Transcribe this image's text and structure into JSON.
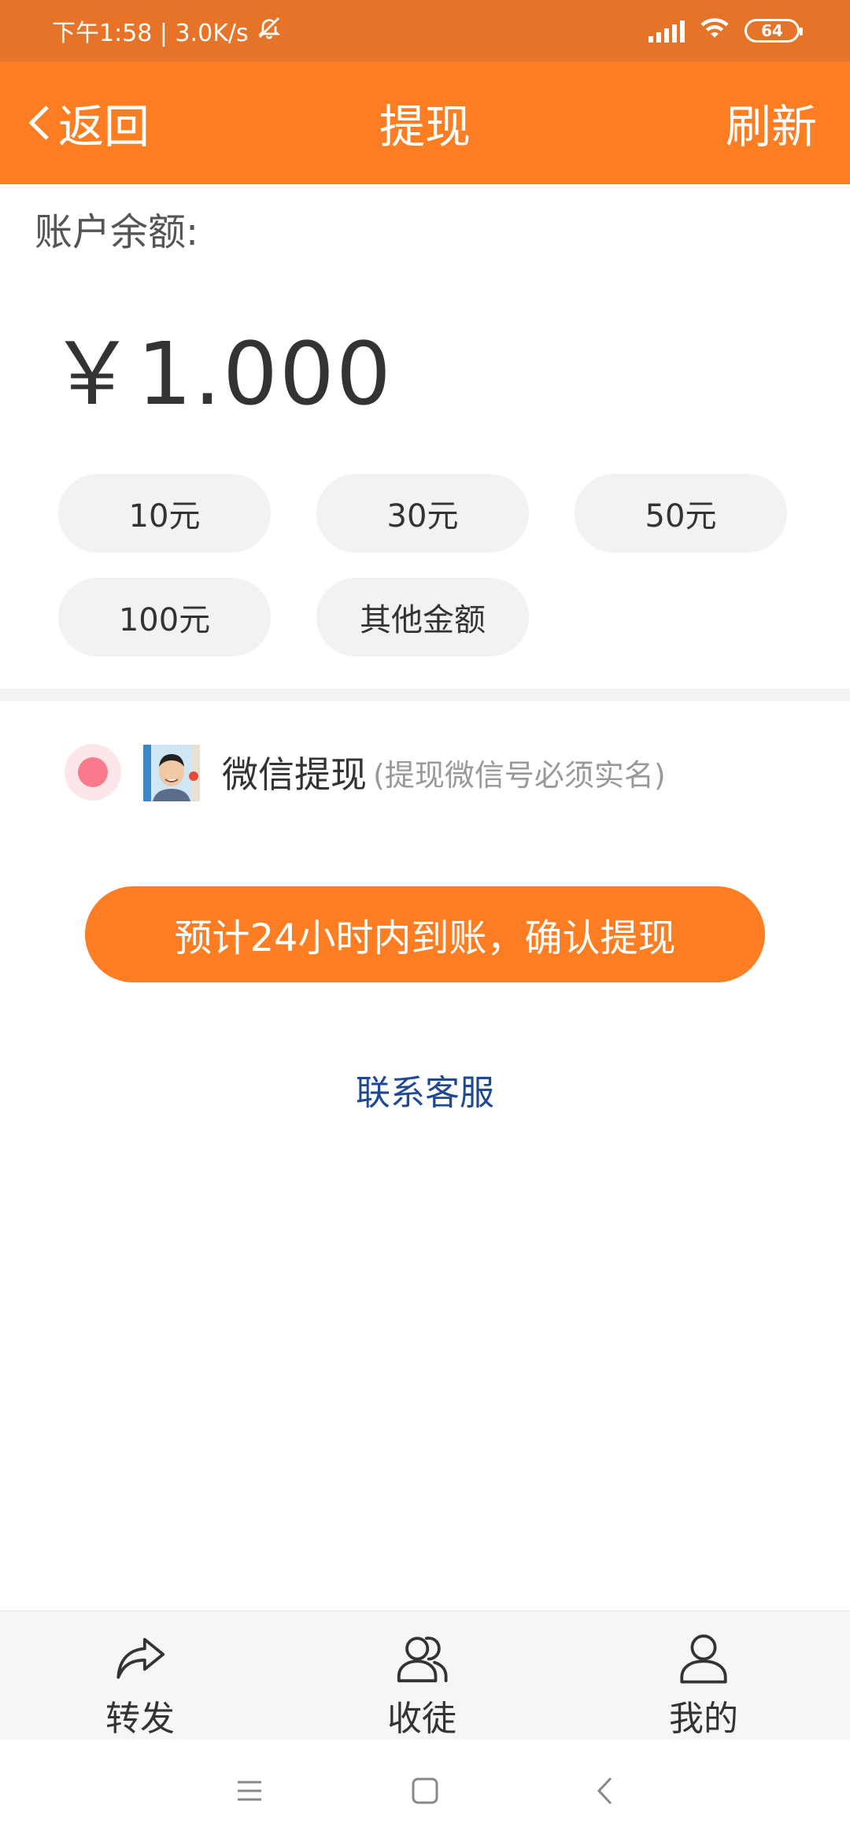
{
  "status_bar": {
    "time_speed": "下午1:58 | 3.0K/s",
    "battery": "64"
  },
  "header": {
    "back_label": "返回",
    "title": "提现",
    "refresh_label": "刷新"
  },
  "balance": {
    "label": "账户余额:",
    "value": "￥1.000"
  },
  "amount_options": [
    "10元",
    "30元",
    "50元",
    "100元",
    "其他金额"
  ],
  "withdraw_method": {
    "label": "微信提现",
    "note": "(提现微信号必须实名)"
  },
  "confirm_button": "预计24小时内到账，确认提现",
  "contact_link": "联系客服",
  "bottom_nav": {
    "items": [
      {
        "label": "转发",
        "icon": "share-icon"
      },
      {
        "label": "收徒",
        "icon": "recruit-icon"
      },
      {
        "label": "我的",
        "icon": "profile-icon"
      }
    ]
  },
  "colors": {
    "primary": "#fd7e22",
    "status_bar": "#e57428",
    "link": "#1f4a93",
    "radio": "#f97a8d"
  }
}
